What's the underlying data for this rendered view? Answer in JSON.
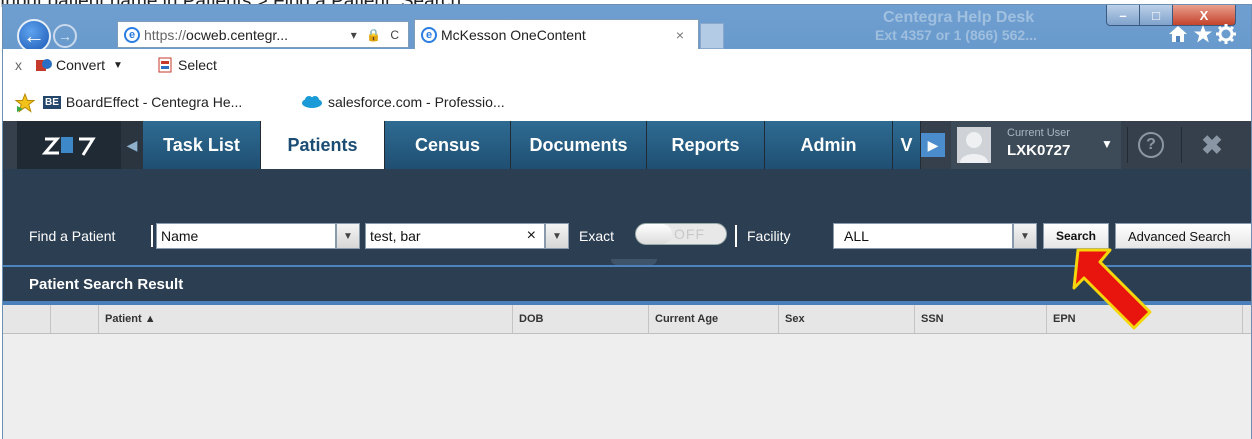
{
  "caption": "Input patient name in Patients > Find a Patient; Search",
  "browser": {
    "back_label": "←",
    "forward_label": "→",
    "url_scheme": "https://",
    "url_host": "ocweb.centegr...",
    "url_controls": "▾ 🔒 C",
    "tab_title": "McKesson OneContent",
    "tab_close": "×",
    "bg_text_1": "Centegra Help Desk",
    "bg_text_2": "Ext 4357 or 1 (866) 562...",
    "window_min": "–",
    "window_max": "□",
    "window_close": "X"
  },
  "toolbar": {
    "close_label": "x",
    "convert_label": "Convert",
    "select_label": "Select"
  },
  "favorites": {
    "items": [
      {
        "label": "BoardEffect - Centegra He...",
        "icon": "be"
      },
      {
        "label": "salesforce.com - Professio...",
        "icon": "cloud"
      }
    ]
  },
  "app_nav": {
    "tabs": [
      {
        "label": "Task List"
      },
      {
        "label": "Patients"
      },
      {
        "label": "Census"
      },
      {
        "label": "Documents"
      },
      {
        "label": "Reports"
      },
      {
        "label": "Admin"
      },
      {
        "label": "V"
      }
    ],
    "active_tab": "Patients",
    "current_user_caption": "Current User",
    "current_user": "LXK0727",
    "help_label": "?",
    "close_label": "✖"
  },
  "search": {
    "find_label": "Find a Patient",
    "field_type": "Name",
    "query": "test, bar",
    "clear_label": "×",
    "exact_label": "Exact",
    "exact_toggle": "OFF",
    "facility_label": "Facility",
    "facility_value": "ALL",
    "search_button": "Search",
    "advanced_button": "Advanced Search"
  },
  "results": {
    "title": "Patient Search Result",
    "columns": [
      "Patient ▲",
      "DOB",
      "Current Age",
      "Sex",
      "SSN",
      "EPN"
    ]
  },
  "colors": {
    "nav_bg": "#35404c",
    "search_bg": "#2c3e52",
    "arrow": "#e8150f"
  }
}
